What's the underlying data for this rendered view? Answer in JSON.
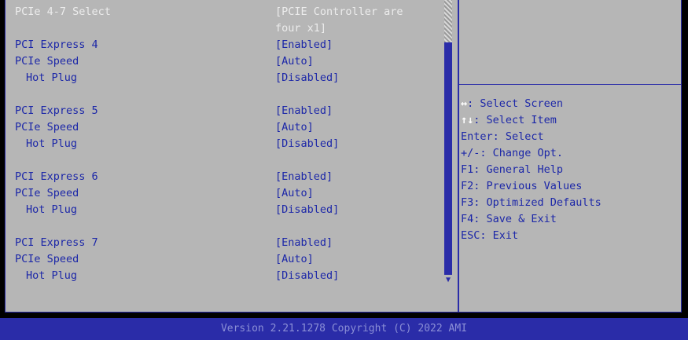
{
  "settings": {
    "rows": [
      {
        "label": "PCIe 4-7 Select",
        "value": "[PCIE Controller are"
      },
      {
        "label": "",
        "value": "four x1]"
      },
      {
        "label": "PCI Express 4",
        "value": "[Enabled]"
      },
      {
        "label": "PCIe Speed",
        "value": "[Auto]"
      },
      {
        "label": "Hot Plug",
        "value": "[Disabled]"
      },
      {
        "label": "PCI Express 5",
        "value": "[Enabled]"
      },
      {
        "label": "PCIe Speed",
        "value": "[Auto]"
      },
      {
        "label": "Hot Plug",
        "value": "[Disabled]"
      },
      {
        "label": "PCI Express 6",
        "value": "[Enabled]"
      },
      {
        "label": "PCIe Speed",
        "value": "[Auto]"
      },
      {
        "label": "Hot Plug",
        "value": "[Disabled]"
      },
      {
        "label": "PCI Express 7",
        "value": "[Enabled]"
      },
      {
        "label": "PCIe Speed",
        "value": "[Auto]"
      },
      {
        "label": "Hot Plug",
        "value": "[Disabled]"
      }
    ]
  },
  "help": {
    "select_screen": {
      "key": "↔",
      "text": ": Select Screen"
    },
    "select_item": {
      "key": "↑↓",
      "text": ": Select Item"
    },
    "enter": "Enter: Select",
    "change": "+/-: Change Opt.",
    "f1": "F1: General Help",
    "f2": "F2: Previous Values",
    "f3": "F3: Optimized Defaults",
    "f4": "F4: Save & Exit",
    "esc": "ESC: Exit"
  },
  "scrollbar": {
    "arrow_glyph": "▼"
  },
  "footer": {
    "text": "Version 2.21.1278 Copyright (C) 2022 AMI"
  },
  "colors": {
    "panel": "#b6b6b6",
    "accent": "#2a2ca8",
    "highlight": "#ececec"
  }
}
